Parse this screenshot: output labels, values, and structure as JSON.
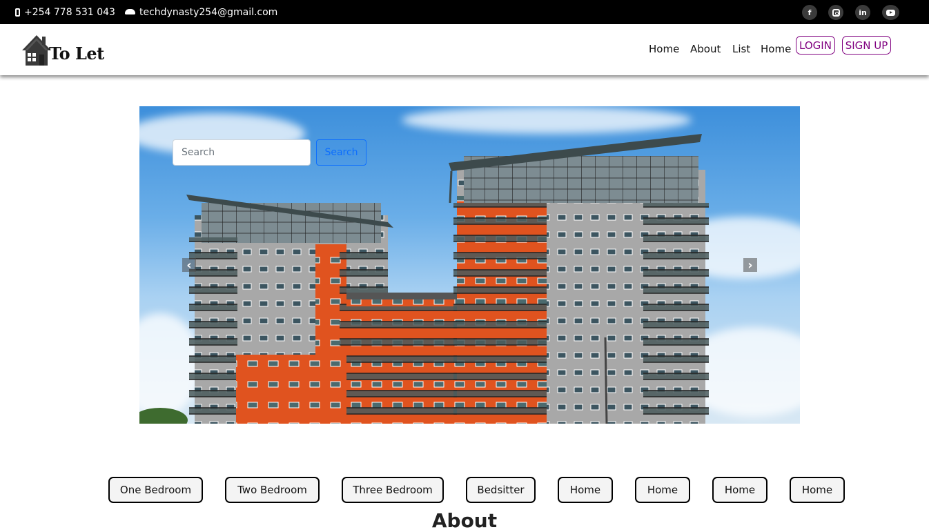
{
  "topbar": {
    "phone": "+254 778 531 043",
    "email": "techdynasty254@gmail.com",
    "social": [
      {
        "name": "facebook",
        "glyph": "f"
      },
      {
        "name": "instagram",
        "glyph": ""
      },
      {
        "name": "linkedin",
        "glyph": "in"
      },
      {
        "name": "youtube",
        "glyph": ""
      }
    ]
  },
  "logo": {
    "text": "To Let"
  },
  "nav": {
    "links": [
      "Home",
      "About",
      "List",
      "Home"
    ],
    "login_label": "LOGIN",
    "signup_label": "SIGN UP"
  },
  "hero": {
    "search_placeholder": "Search",
    "search_button": "Search",
    "prev_glyph": "‹",
    "next_glyph": "›"
  },
  "categories": [
    "One Bedroom",
    "Two Bedroom",
    "Three Bedroom",
    "Bedsitter",
    "Home",
    "Home",
    "Home",
    "Home"
  ],
  "sections": {
    "about_heading": "About"
  },
  "colors": {
    "accent": "#800080",
    "topbar": "#000000",
    "search_button": "#0d6efd"
  }
}
